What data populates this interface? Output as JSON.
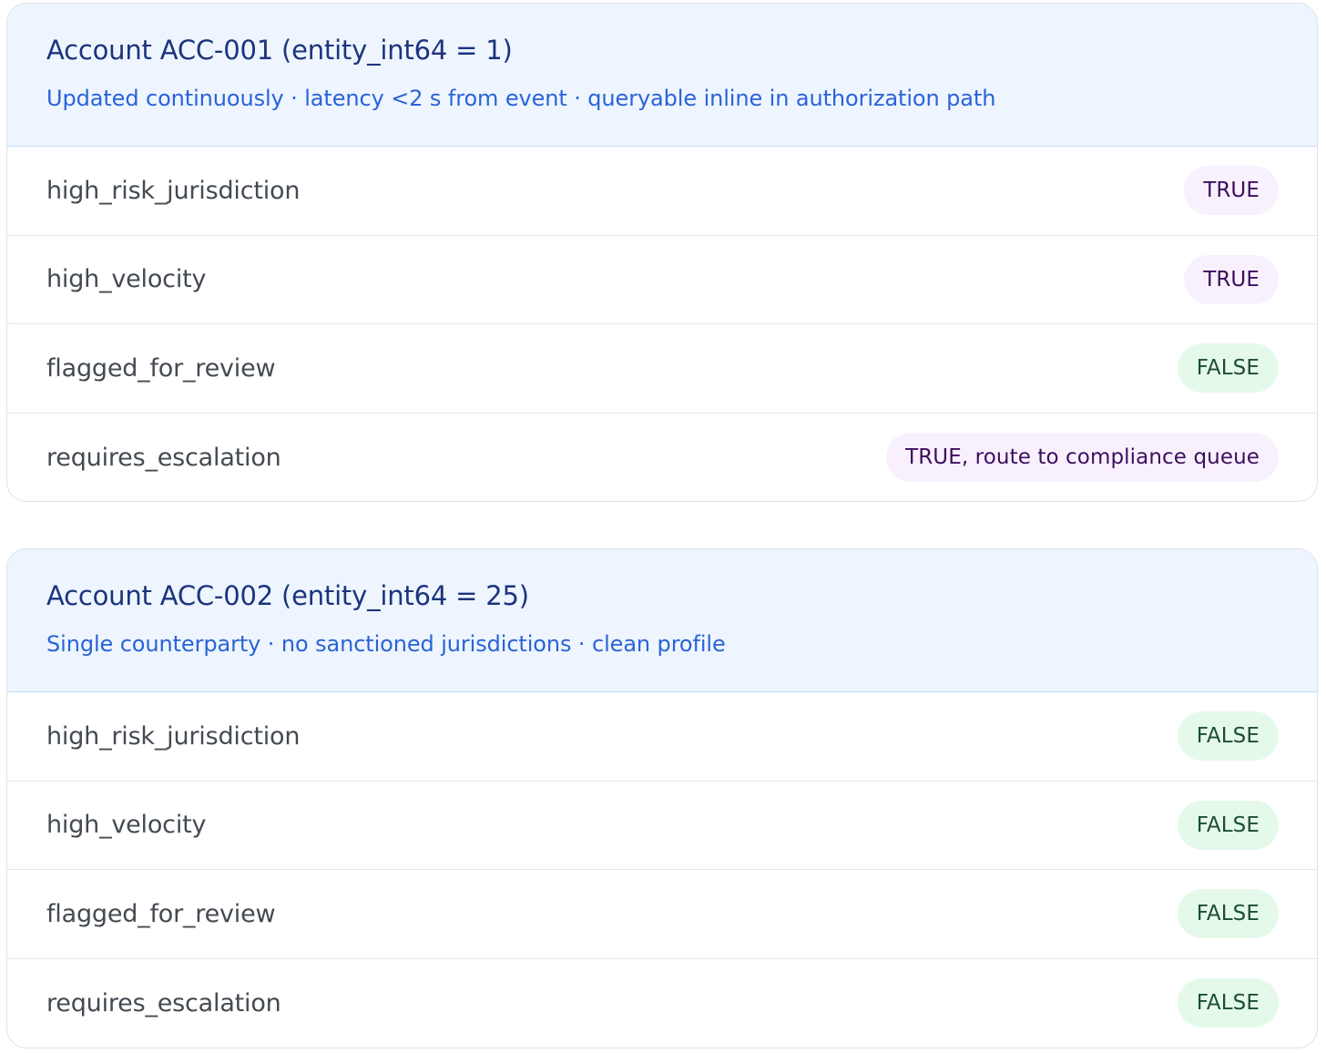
{
  "colors": {
    "header_bg": "#eef5fe",
    "title": "#1c347e",
    "subtitle": "#2a63d8",
    "true_badge_bg": "#f8f1fd",
    "true_badge_text": "#3d0e5e",
    "false_badge_bg": "#e5f9eb",
    "false_badge_text": "#1c4f2f"
  },
  "accounts": [
    {
      "title": "Account ACC-001 (entity_int64 = 1)",
      "subtitle": "Updated continuously · latency <2 s from event · queryable inline in authorization path",
      "rows": [
        {
          "label": "high_risk_jurisdiction",
          "value": "TRUE",
          "status": "true"
        },
        {
          "label": "high_velocity",
          "value": "TRUE",
          "status": "true"
        },
        {
          "label": "flagged_for_review",
          "value": "FALSE",
          "status": "false"
        },
        {
          "label": "requires_escalation",
          "value": "TRUE, route to compliance queue",
          "status": "true"
        }
      ]
    },
    {
      "title": "Account ACC-002 (entity_int64 = 25)",
      "subtitle": "Single counterparty · no sanctioned jurisdictions · clean profile",
      "rows": [
        {
          "label": "high_risk_jurisdiction",
          "value": "FALSE",
          "status": "false"
        },
        {
          "label": "high_velocity",
          "value": "FALSE",
          "status": "false"
        },
        {
          "label": "flagged_for_review",
          "value": "FALSE",
          "status": "false"
        },
        {
          "label": "requires_escalation",
          "value": "FALSE",
          "status": "false"
        }
      ]
    }
  ]
}
